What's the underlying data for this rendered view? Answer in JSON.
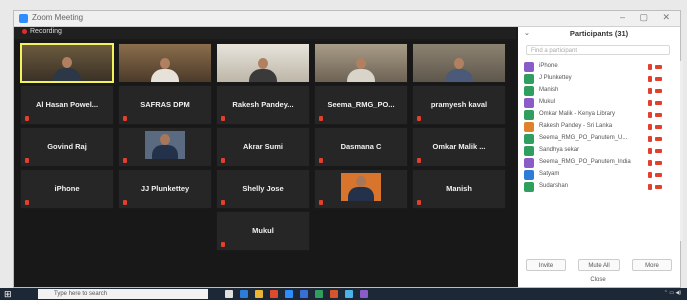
{
  "window": {
    "title": "Zoom Meeting"
  },
  "meeting": {
    "recording_label": "Recording"
  },
  "gallery": {
    "row1": [
      {
        "name": "Al Hasan Powel..."
      },
      {
        "name": "SAFRAS DPM"
      },
      {
        "name": "Rakesh Pandey..."
      },
      {
        "name": "Seema_RMG_PO..."
      },
      {
        "name": "pramyesh kaval"
      }
    ],
    "row2": [
      {
        "name": "Govind Raj"
      },
      {
        "name": "",
        "caption": ""
      },
      {
        "name": "Akrar Sumi"
      },
      {
        "name": "Dasmana C"
      },
      {
        "name": "Omkar Malik ..."
      }
    ],
    "row3": [
      {
        "name": "iPhone"
      },
      {
        "name": "JJ Plunkettey"
      },
      {
        "name": "Shelly Jose"
      },
      {
        "name": "",
        "caption": ""
      },
      {
        "name": "Manish"
      }
    ],
    "row4": [
      {
        "name": "Mukul"
      }
    ]
  },
  "participants": {
    "header": "Participants (31)",
    "search_placeholder": "Find a participant",
    "items": [
      {
        "name": "iPhone",
        "color": "#8a5cc8"
      },
      {
        "name": "J Plunkettey",
        "color": "#2f9e5f"
      },
      {
        "name": "Manish",
        "color": "#2f9e5f"
      },
      {
        "name": "Mukul",
        "color": "#8a5cc8"
      },
      {
        "name": "Omkar Malik - Kenya Library",
        "color": "#2f9e5f"
      },
      {
        "name": "Rakesh Pandey - Sri Lanka",
        "color": "#e0822c"
      },
      {
        "name": "Seema_RMG_PO_Panutem_U...",
        "color": "#2f9e5f"
      },
      {
        "name": "Sandhya sekar",
        "color": "#2f9e5f"
      },
      {
        "name": "Seema_RMG_PO_Panutem_lndia",
        "color": "#8a5cc8"
      },
      {
        "name": "Satyam",
        "color": "#2d7cd8"
      },
      {
        "name": "Sudarshan",
        "color": "#2f9e5f"
      }
    ],
    "buttons": {
      "invite": "Invite",
      "mute_all": "Mute All",
      "more": "More"
    },
    "close": "Close"
  },
  "taskbar": {
    "search_placeholder": "Type here to search"
  }
}
